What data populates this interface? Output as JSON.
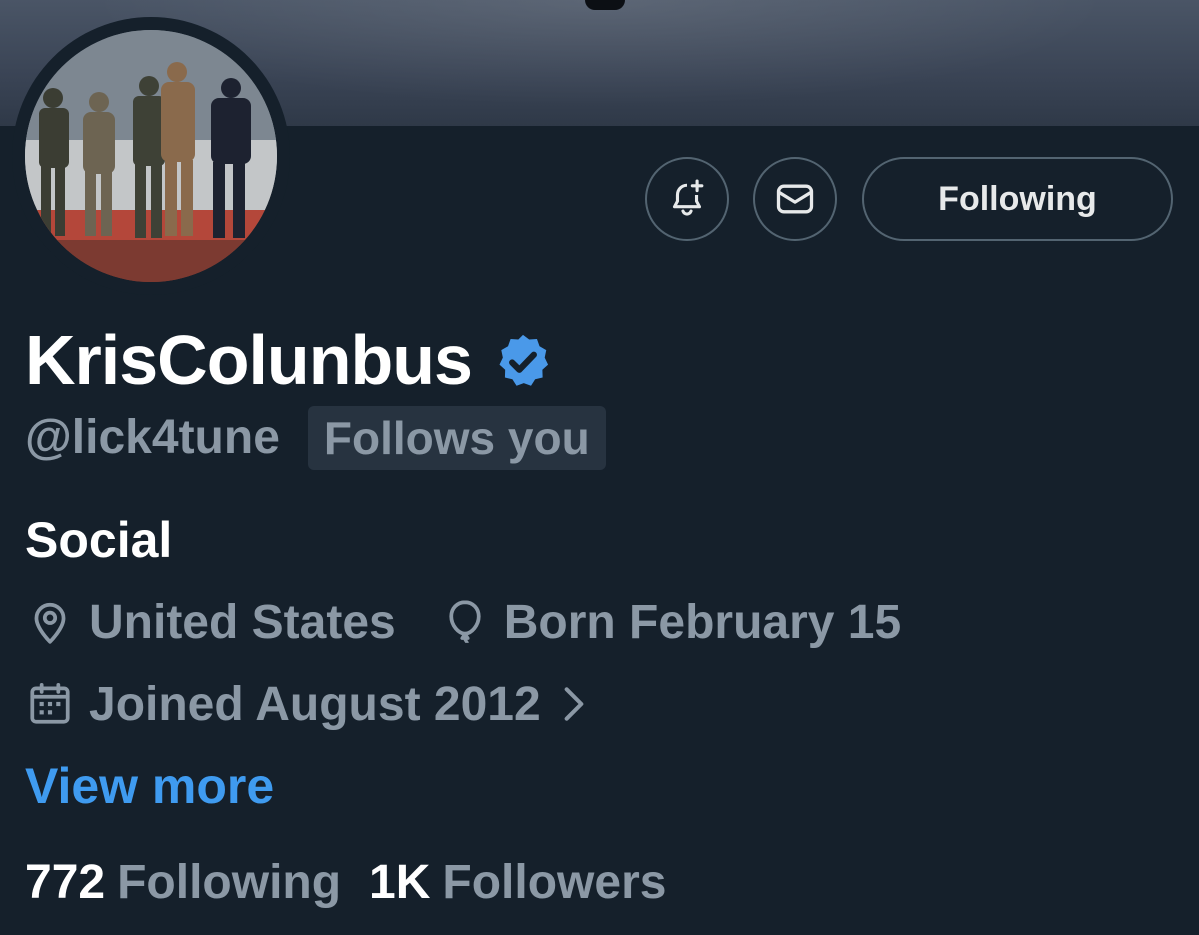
{
  "header": {
    "actions": {
      "notify_icon": "bell-plus-icon",
      "message_icon": "envelope-icon",
      "following_label": "Following"
    }
  },
  "profile": {
    "display_name": "KrisColunbus",
    "verified_icon": "verified-badge-icon",
    "verified_color": "#4a99e9",
    "handle": "@lick4tune",
    "follows_you_label": "Follows you",
    "bio": "Social",
    "location": "United States",
    "birthday": "Born February 15",
    "joined": "Joined August 2012",
    "view_more_label": "View more",
    "accent_color": "#3f9bf0"
  },
  "stats": {
    "following_count": "772",
    "following_label": "Following",
    "followers_count": "1K",
    "followers_label": "Followers"
  }
}
